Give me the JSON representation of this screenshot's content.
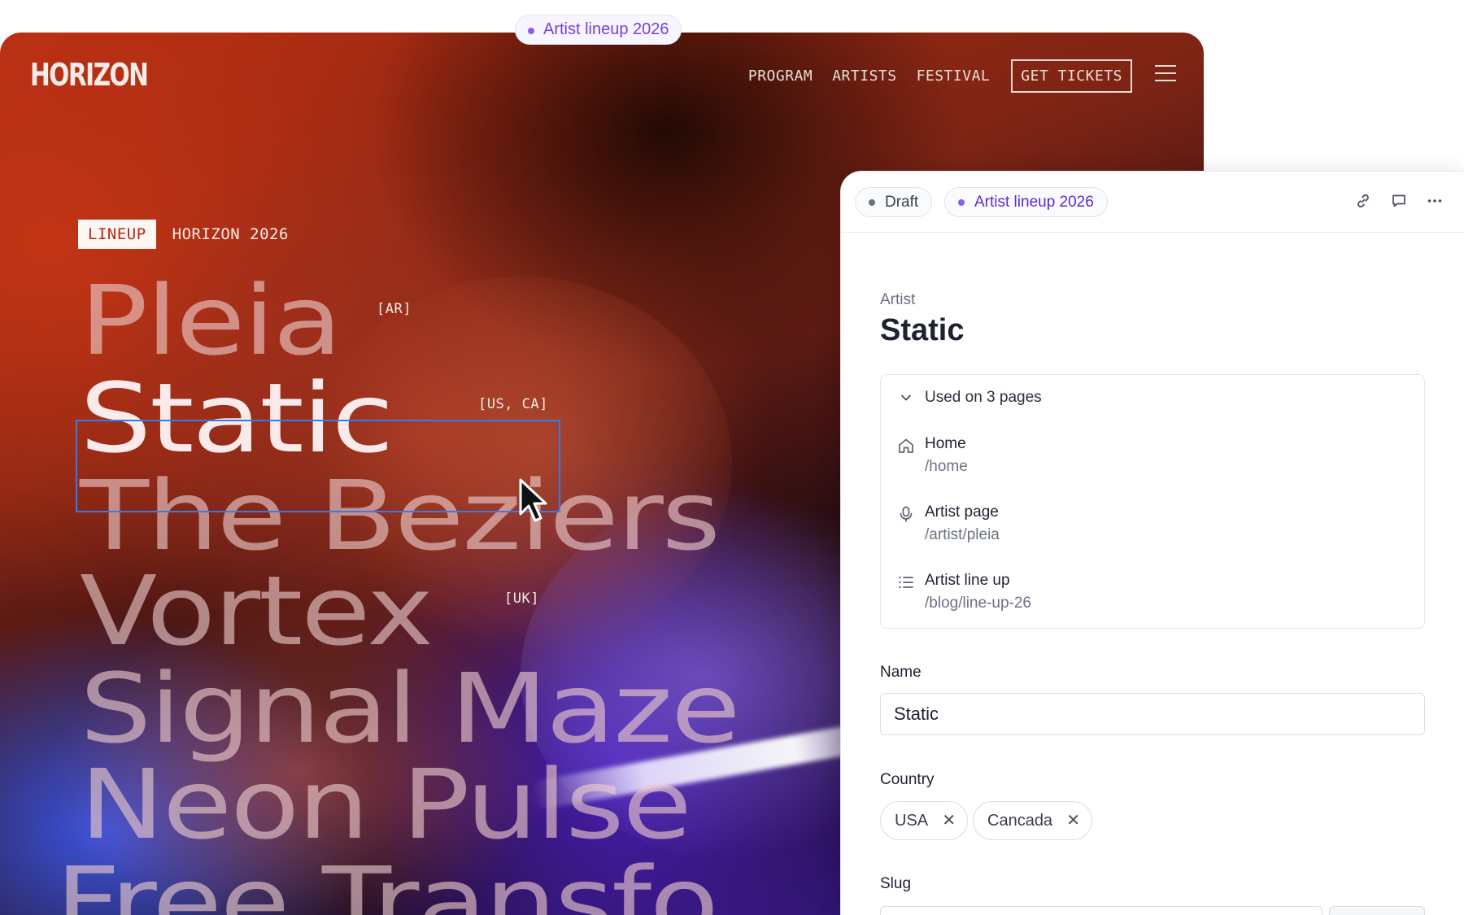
{
  "top_pill": {
    "label": "Artist lineup 2026"
  },
  "site": {
    "logo": "HORIZON",
    "nav": {
      "program": "PROGRAM",
      "artists": "ARTISTS",
      "festival": "FESTIVAL",
      "cta": "GET TICKETS"
    },
    "tag": {
      "box": "LINEUP",
      "text": "HORIZON 2026"
    },
    "lineup": [
      {
        "name": "Pleia",
        "country": "[AR]"
      },
      {
        "name": "Static",
        "country": "[US, CA]"
      },
      {
        "name": "The Beziers",
        "country": ""
      },
      {
        "name": "Vortex",
        "country": "[UK]"
      },
      {
        "name": "Signal Maze",
        "country": ""
      },
      {
        "name": "Neon Pulse",
        "country": ""
      },
      {
        "name": "Free Transfo",
        "country": ""
      }
    ]
  },
  "panel": {
    "status": "Draft",
    "release": "Artist lineup 2026",
    "doc_type": "Artist",
    "doc_title": "Static",
    "used_on": "Used on 3 pages",
    "references": [
      {
        "icon": "home-icon",
        "title": "Home",
        "path": "/home"
      },
      {
        "icon": "microphone-icon",
        "title": "Artist page",
        "path": "/artist/pleia"
      },
      {
        "icon": "list-icon",
        "title": "Artist line up",
        "path": "/blog/line-up-26"
      }
    ],
    "name_label": "Name",
    "name_value": "Static",
    "country_label": "Country",
    "countries": [
      "USA",
      "Cancada"
    ],
    "chip_remove": "✕",
    "slug_label": "Slug"
  },
  "colors": {
    "accent": "#8b5cf6",
    "selection": "#2d7ff0",
    "tag_red": "#b52a15"
  }
}
